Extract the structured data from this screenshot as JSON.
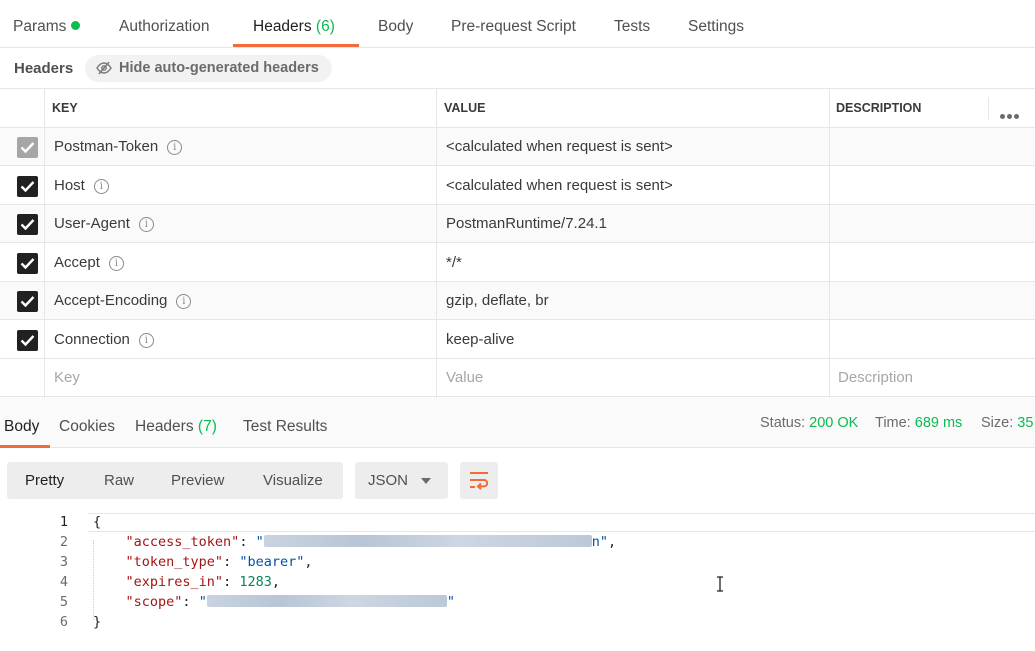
{
  "request_tabs": [
    {
      "label": "Params",
      "count": ""
    },
    {
      "label": "Authorization",
      "count": ""
    },
    {
      "label": "Headers",
      "count": "(6)"
    },
    {
      "label": "Body",
      "count": ""
    },
    {
      "label": "Pre-request Script",
      "count": ""
    },
    {
      "label": "Tests",
      "count": ""
    },
    {
      "label": "Settings",
      "count": ""
    }
  ],
  "headers_bar": {
    "title": "Headers",
    "hide_toggle": "Hide auto-generated headers"
  },
  "table": {
    "columns": [
      "KEY",
      "VALUE",
      "DESCRIPTION"
    ],
    "rows": [
      {
        "key": "Postman-Token",
        "value": "<calculated when request is sent>",
        "checked": true,
        "disabled": true
      },
      {
        "key": "Host",
        "value": "<calculated when request is sent>",
        "checked": true,
        "disabled": false
      },
      {
        "key": "User-Agent",
        "value": "PostmanRuntime/7.24.1",
        "checked": true,
        "disabled": false
      },
      {
        "key": "Accept",
        "value": "*/*",
        "checked": true,
        "disabled": false
      },
      {
        "key": "Accept-Encoding",
        "value": "gzip, deflate, br",
        "checked": true,
        "disabled": false
      },
      {
        "key": "Connection",
        "value": "keep-alive",
        "checked": true,
        "disabled": false
      }
    ],
    "placeholder": {
      "key": "Key",
      "value": "Value",
      "description": "Description"
    }
  },
  "response_tabs": [
    {
      "label": "Body",
      "count": ""
    },
    {
      "label": "Cookies",
      "count": ""
    },
    {
      "label": "Headers",
      "count": "(7)"
    },
    {
      "label": "Test Results",
      "count": ""
    }
  ],
  "status": {
    "status_label": "Status:",
    "status_value": "200 OK",
    "time_label": "Time:",
    "time_value": "689 ms",
    "size_label": "Size:",
    "size_value": "35"
  },
  "view_modes": [
    "Pretty",
    "Raw",
    "Preview",
    "Visualize"
  ],
  "format": "JSON",
  "code": {
    "line_numbers": [
      "1",
      "2",
      "3",
      "4",
      "5",
      "6"
    ],
    "open_brace": "{",
    "close_brace": "}",
    "access_token_key": "\"access_token\"",
    "token_type_key": "\"token_type\"",
    "token_type_value": "\"bearer\"",
    "expires_in_key": "\"expires_in\"",
    "expires_in_value": "1283",
    "scope_key": "\"scope\""
  },
  "colors": {
    "accent": "#f26b3a",
    "success": "#0cbb52"
  }
}
